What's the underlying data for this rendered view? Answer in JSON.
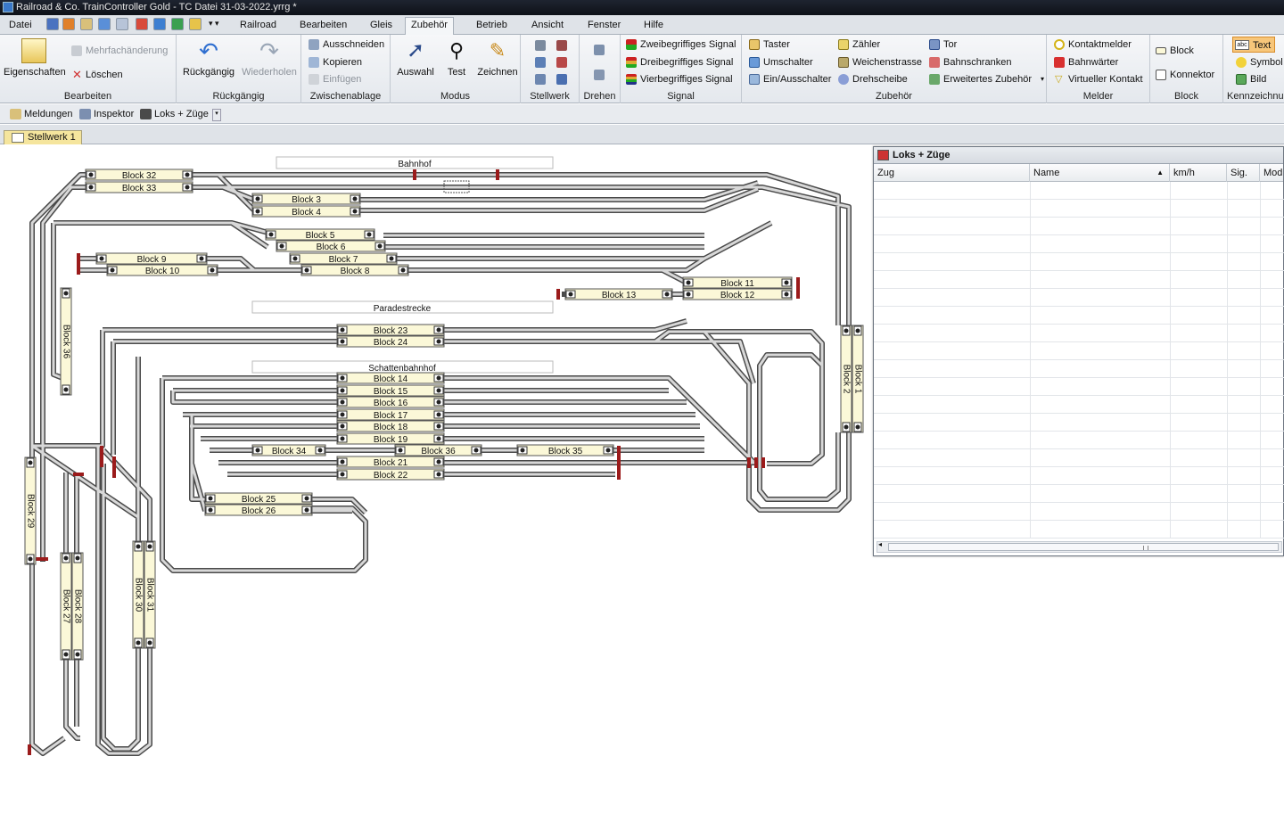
{
  "window": {
    "title": "Railroad & Co. TrainController Gold - TC Datei 31-03-2022.yrrg *"
  },
  "menu": {
    "file": "Datei",
    "tabs": [
      "Railroad",
      "Bearbeiten",
      "Gleis",
      "Zubehör",
      "Betrieb",
      "Ansicht",
      "Fenster",
      "Hilfe"
    ],
    "active_tab": "Zubehör"
  },
  "ribbon": {
    "bearbeiten": {
      "label": "Bearbeiten",
      "eigenschaften": "Eigenschaften",
      "mehrfach": "Mehrfachänderung",
      "loeschen": "Löschen"
    },
    "rueckgaengig": {
      "label": "Rückgängig",
      "undo": "Rückgängig",
      "redo": "Wiederholen"
    },
    "zwischenablage": {
      "label": "Zwischenablage",
      "cut": "Ausschneiden",
      "copy": "Kopieren",
      "paste": "Einfügen"
    },
    "modus": {
      "label": "Modus",
      "auswahl": "Auswahl",
      "test": "Test",
      "zeichnen": "Zeichnen"
    },
    "stellwerk": {
      "label": "Stellwerk"
    },
    "drehen": {
      "label": "Drehen"
    },
    "signal": {
      "label": "Signal",
      "items": [
        "Zweibegriffiges Signal",
        "Dreibegriffiges Signal",
        "Vierbegriffiges Signal"
      ]
    },
    "zubehoer": {
      "label": "Zubehör",
      "col1": [
        "Taster",
        "Umschalter",
        "Ein/Ausschalter"
      ],
      "col2": [
        "Zähler",
        "Weichenstrasse",
        "Drehscheibe"
      ],
      "col3": [
        "Tor",
        "Bahnschranken",
        "Erweitertes Zubehör"
      ]
    },
    "melder": {
      "label": "Melder",
      "items": [
        "Kontaktmelder",
        "Bahnwärter",
        "Virtueller Kontakt"
      ]
    },
    "block": {
      "label": "Block",
      "items": [
        "Block",
        "Konnektor"
      ]
    },
    "kennzeichnung": {
      "label": "Kennzeichnun",
      "items": [
        "Text",
        "Symbol",
        "Bild"
      ]
    }
  },
  "toolbar": {
    "items": [
      "Meldungen",
      "Inspektor",
      "Loks + Züge"
    ]
  },
  "document": {
    "tab": "Stellwerk 1"
  },
  "panel": {
    "title": "Loks + Züge",
    "columns": [
      "Zug",
      "Name",
      "km/h",
      "Sig.",
      "Mod"
    ]
  },
  "layout": {
    "labels": {
      "bahnhof": "Bahnhof",
      "paradestrecke": "Paradestrecke",
      "schattenbahnhof": "Schattenbahnhof"
    },
    "blocks": {
      "b32": "Block 32",
      "b33": "Block 33",
      "b3": "Block 3",
      "b4": "Block 4",
      "b5": "Block 5",
      "b6": "Block 6",
      "b7": "Block 7",
      "b8": "Block 8",
      "b9": "Block 9",
      "b10": "Block 10",
      "b11": "Block 11",
      "b12": "Block 12",
      "b13": "Block 13",
      "b23": "Block 23",
      "b24": "Block 24",
      "b14": "Block 14",
      "b15": "Block 15",
      "b16": "Block 16",
      "b17": "Block 17",
      "b18": "Block 18",
      "b19": "Block 19",
      "b34": "Block 34",
      "b36h": "Block 36",
      "b35": "Block 35",
      "b21": "Block 21",
      "b22": "Block 22",
      "b25": "Block 25",
      "b26": "Block 26",
      "b36v": "Block 36",
      "b29": "Block 29",
      "b27": "Block 27",
      "b28": "Block 28",
      "b30": "Block 30",
      "b31": "Block 31",
      "b1": "Block 1",
      "b2": "Block 2"
    }
  },
  "colors": {
    "track": "#4a4a4a",
    "track_inner": "#d8d8d8",
    "block_fill": "#fbf8d8",
    "stop": "#9b1b1b",
    "doctab": "#f5e59d"
  }
}
